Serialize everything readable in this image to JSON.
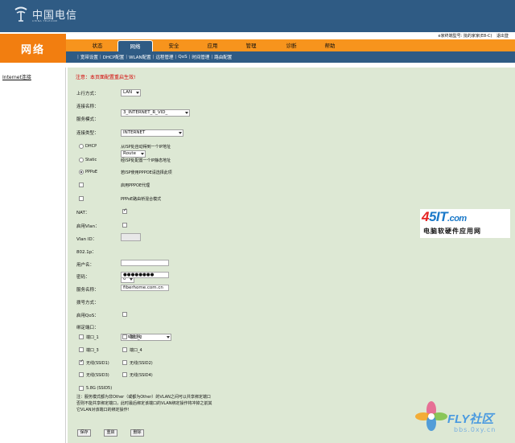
{
  "header": {
    "logo_text": "中国电信",
    "logo_sub": "CHINA TELECOM",
    "user_info": "e家终端型号: 批的家家(E8-C)",
    "logout_label": "退出登"
  },
  "section_title": "网络",
  "tabs": [
    {
      "label": "状态",
      "active": false
    },
    {
      "label": "网络",
      "active": true
    },
    {
      "label": "安全",
      "active": false
    },
    {
      "label": "应用",
      "active": false
    },
    {
      "label": "管理",
      "active": false
    },
    {
      "label": "诊断",
      "active": false
    },
    {
      "label": "帮助",
      "active": false
    }
  ],
  "subtabs": [
    "宽带设置",
    "DHCP配置",
    "WLAN配置",
    "远程管理",
    "QoS",
    "时间管理",
    "路由配置"
  ],
  "sidebar": {
    "items": [
      {
        "label": "Internet连接"
      }
    ]
  },
  "form": {
    "notice": "注意：本页面配置重启生效!",
    "uplink": {
      "label": "上行方式：",
      "value": "LAN"
    },
    "conn_name": {
      "label": "连接名称：",
      "value": "3_INTERNET_R_VID_"
    },
    "service_mode": {
      "label": "服务模式：",
      "value": "INTERNET"
    },
    "conn_type": {
      "label": "连接类型：",
      "value": "Route"
    },
    "modes": [
      {
        "label": "DHCP",
        "desc": "从ISP处自动得到一个IP地址",
        "selected": false
      },
      {
        "label": "Static",
        "desc": "经ISP处配置一个IP静态地址",
        "selected": false
      },
      {
        "label": "PPPoE",
        "desc": "若ISP使用PPPOE请选择此项",
        "selected": true
      }
    ],
    "pppoe_proxy": {
      "desc": "启用PPPOE代理",
      "checked": false
    },
    "pppoe_bridge": {
      "desc": "PPPoE路由桥混合模式",
      "checked": false
    },
    "nat": {
      "label": "NAT：",
      "checked": true
    },
    "vlan_enable": {
      "label": "启用Vlan：",
      "checked": false
    },
    "vlan_id": {
      "label": "Vlan ID：",
      "value": ""
    },
    "dot1p": {
      "label": "802.1p：",
      "value": "0"
    },
    "username": {
      "label": "用户名：",
      "value": ""
    },
    "password": {
      "label": "密码：",
      "value": "●●●●●●●●"
    },
    "service_name": {
      "label": "服务名称：",
      "value": "fiberhome.com.cn"
    },
    "dial_mode": {
      "label": "拨号方式：",
      "value": "自动连接"
    },
    "qos": {
      "label": "启用QoS：",
      "checked": false
    },
    "bind_port": {
      "label": "绑定端口："
    },
    "ports": [
      {
        "label": "端口_1",
        "checked": false
      },
      {
        "label": "端口_2",
        "checked": false
      },
      {
        "label": "端口_3",
        "checked": false
      },
      {
        "label": "端口_4",
        "checked": false
      },
      {
        "label": "无线(SSID1)",
        "checked": true
      },
      {
        "label": "无线(SSID2)",
        "checked": false
      },
      {
        "label": "无线(SSID3)",
        "checked": false
      },
      {
        "label": "无线(SSID4)",
        "checked": false
      },
      {
        "label": "5.8G (SSID5)",
        "checked": false
      }
    ],
    "note_line1": "注：服务模式都为非Other（或都为Other）的VLAN之间可以共享绑定端口",
    "note_line2": "否则不能共享绑定端口，此时最后绑定该端口的VLAN绑定操作将冲掉之前其",
    "note_line3": "它VLAN对该端口的绑定操作!",
    "buttons": {
      "save": "保存",
      "reset": "重启",
      "delete": "删除"
    }
  },
  "watermarks": {
    "site1_prefix": "4",
    "site1_main": "5IT",
    "site1_suffix": ".com",
    "site1_sub": "电脑软硬件应用网",
    "site2_title": "FLY社区",
    "site2_sub": "bbs.0xy.cn"
  },
  "colors": {
    "banner": "#2f5b84",
    "accent_orange": "#f7941d",
    "content_bg": "#dde8d4",
    "notice_red": "#d40000"
  }
}
